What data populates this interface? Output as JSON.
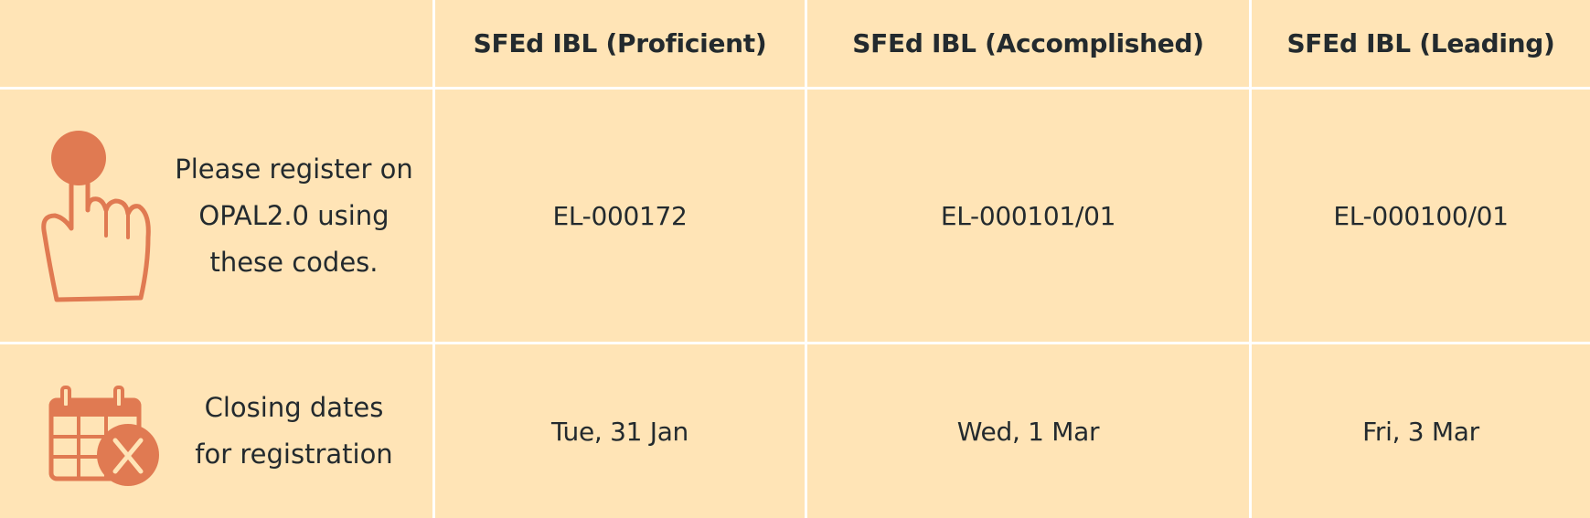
{
  "header": {
    "columns": [
      "SFEd IBL (Proficient)",
      "SFEd IBL (Accomplished)",
      "SFEd IBL (Leading)"
    ]
  },
  "rows": [
    {
      "icon": "pointing-hand-icon",
      "label_lines": [
        "Please register on",
        "OPAL2.0 using",
        "these codes."
      ],
      "values": [
        "EL-000172",
        "EL-000101/01",
        "EL-000100/01"
      ]
    },
    {
      "icon": "calendar-cancel-icon",
      "label_lines": [
        "Closing dates",
        "for registration"
      ],
      "values": [
        "Tue, 31 Jan",
        "Wed, 1 Mar",
        "Fri, 3 Mar"
      ]
    }
  ],
  "colors": {
    "background": "#ffe4b6",
    "grid_lines": "#ffffff",
    "icon": "#e07a52",
    "text": "#232a2e"
  }
}
